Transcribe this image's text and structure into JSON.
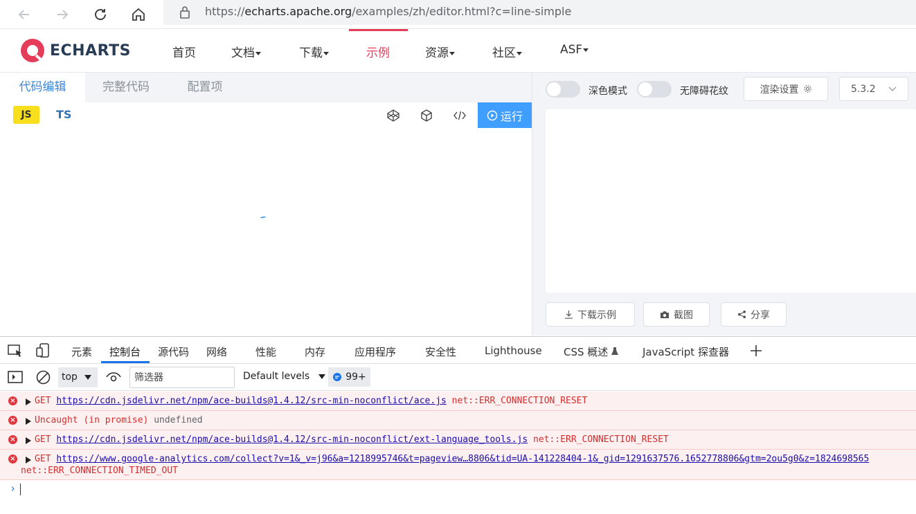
{
  "browser": {
    "url_prefix": "https://",
    "url_host": "echarts.apache.org",
    "url_path": "/examples/zh/editor.html?c=line-simple"
  },
  "site": {
    "logo": "ECHARTS",
    "nav": [
      {
        "label": "首页",
        "caret": false
      },
      {
        "label": "文档",
        "caret": true
      },
      {
        "label": "下载",
        "caret": true
      },
      {
        "label": "示例",
        "caret": false,
        "active": true
      },
      {
        "label": "资源",
        "caret": true
      },
      {
        "label": "社区",
        "caret": true
      },
      {
        "label": "ASF",
        "caret": true
      }
    ]
  },
  "editor": {
    "tabs": [
      "代码编辑",
      "完整代码",
      "配置项"
    ],
    "lang_js": "JS",
    "lang_ts": "TS",
    "run_label": "运行"
  },
  "preview": {
    "dark_mode_label": "深色模式",
    "aria_label": "无障碍花纹",
    "render_settings": "渲染设置",
    "version": "5.3.2",
    "download_label": "下载示例",
    "screenshot_label": "截图",
    "share_label": "分享"
  },
  "devtools": {
    "tabs": [
      "元素",
      "控制台",
      "源代码",
      "网络",
      "性能",
      "内存",
      "应用程序",
      "安全性",
      "Lighthouse",
      "CSS 概述",
      "JavaScript 探查器"
    ],
    "context": "top",
    "filter_placeholder": "筛选器",
    "levels": "Default levels",
    "issues_count": "99+"
  },
  "console": {
    "logs": [
      {
        "prefix": "GET ",
        "link": "https://cdn.jsdelivr.net/npm/ace-builds@1.4.12/src-min-noconflict/ace.js",
        "suffix": " net::ERR_CONNECTION_RESET"
      },
      {
        "prefix": "Uncaught (in promise) ",
        "grey": "undefined"
      },
      {
        "prefix": "GET ",
        "link": "https://cdn.jsdelivr.net/npm/ace-builds@1.4.12/src-min-noconflict/ext-language_tools.js",
        "suffix": " net::ERR_CONNECTION_RESET"
      },
      {
        "prefix": "GET ",
        "link": "https://www.google-analytics.com/collect?v=1&_v=j96&a=1218995746&t=pageview…8806&tid=UA-141228404-1&_gid=1291637576.1652778806&gtm=2ou5g0&z=1824698565",
        "line2": "net::ERR_CONNECTION_TIMED_OUT"
      }
    ]
  }
}
